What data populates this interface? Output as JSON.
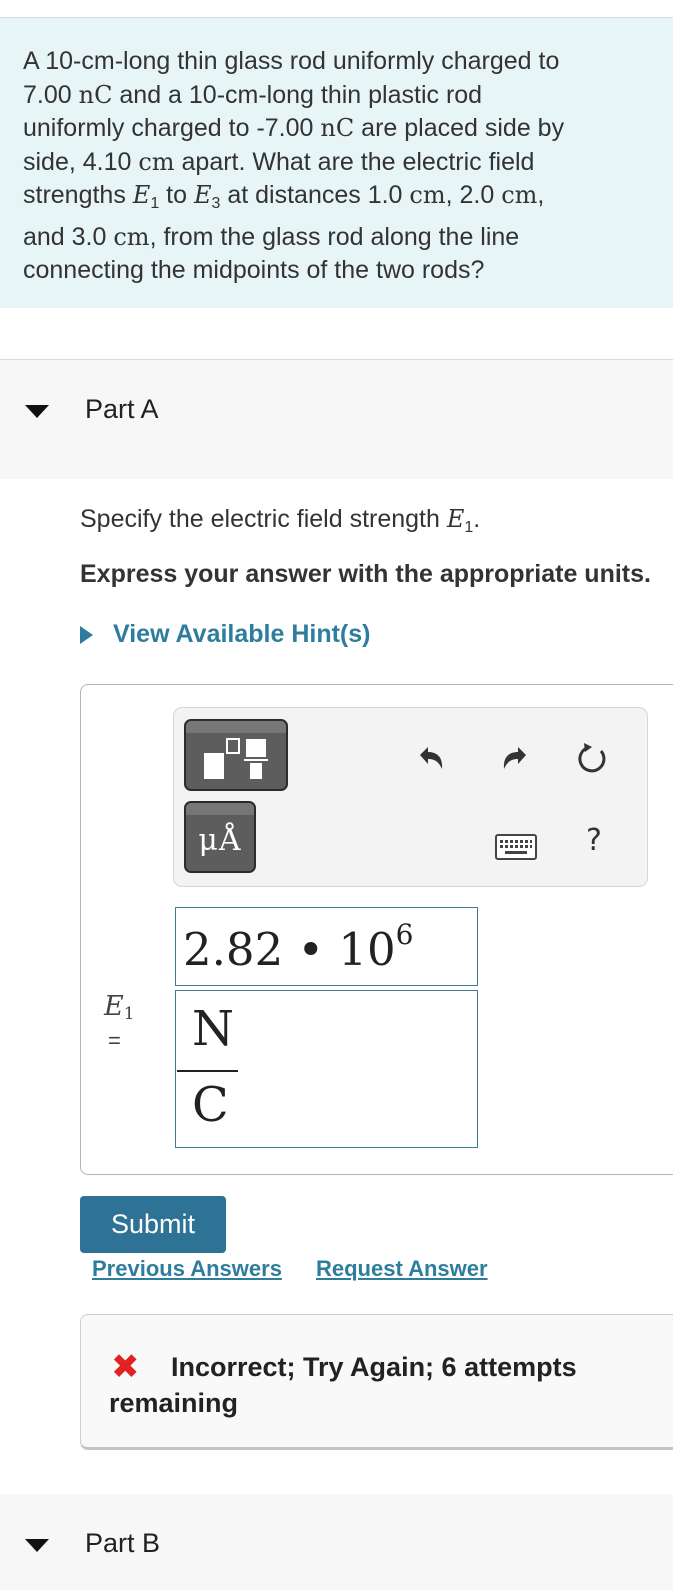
{
  "problem": {
    "t1": "A 10-cm-long thin glass rod uniformly charged to",
    "t2a": "7.00 ",
    "t2_unit": "nC",
    "t2b": " and a 10-cm-long thin plastic rod",
    "t3": "uniformly charged to -7.00 ",
    "t3_unit": "nC",
    "t3b": " are placed side by",
    "t4a": "side, 4.10 ",
    "t4_unit": "cm",
    "t4b": " apart. What are the electric field",
    "t5a": "strengths ",
    "t5_e": "E",
    "t5_e_sub": "1",
    "t5_to": " to ",
    "t5_e3": "E",
    "t5_e3_sub": "3",
    "t5b": " at distances 1.0 ",
    "t5_cm1": "cm",
    "t5c": ", 2.0 ",
    "t5_cm2": "cm",
    "t5d": ",",
    "t6a": "and 3.0 ",
    "t6_cm": "cm",
    "t6b": ", from the glass rod along the line",
    "t7": "connecting the midpoints of the two rods?"
  },
  "part_a": {
    "label": "Part A",
    "specify_prefix": "Specify the electric field strength ",
    "specify_var": "E",
    "specify_sub": "1",
    "specify_suffix": ".",
    "express": "Express your answer with the appropriate units.",
    "hint_label": "View Available Hint(s)"
  },
  "toolbar": {
    "units_glyph": "μÅ",
    "help_label": "?"
  },
  "answer": {
    "var_label": "E",
    "var_sub": "1",
    "equals": "=",
    "value_mantissa": "2.82",
    "value_dot": " • ",
    "value_base": "10",
    "value_exp": "6",
    "unit_numerator": "N",
    "unit_denominator": "C"
  },
  "actions": {
    "submit_label": "Submit",
    "previous_answers_label": "Previous Answers",
    "request_answer_label": "Request Answer"
  },
  "feedback": {
    "icon": "✖",
    "message": "Incorrect; Try Again; 6 attempts remaining",
    "status_color": "#e02222"
  },
  "part_b": {
    "label": "Part B"
  },
  "colors": {
    "accent": "#2f7d9d",
    "problem_bg": "#e8f5f6",
    "submit_bg": "#2e7396"
  }
}
